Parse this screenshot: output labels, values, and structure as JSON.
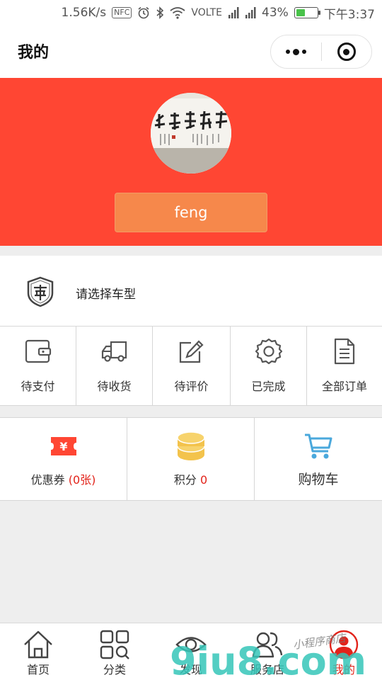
{
  "status_bar": {
    "speed": "1.56K/s",
    "nfc": "NFC",
    "volte": "VOLTE",
    "battery_pct": "43%",
    "battery_level": 0.43,
    "time": "下午3:37"
  },
  "header": {
    "title": "我的"
  },
  "profile": {
    "username": "feng"
  },
  "car_model": {
    "label": "请选择车型"
  },
  "orders": [
    {
      "label": "待支付",
      "icon": "wallet-icon"
    },
    {
      "label": "待收货",
      "icon": "truck-icon"
    },
    {
      "label": "待评价",
      "icon": "edit-icon"
    },
    {
      "label": "已完成",
      "icon": "gear-icon"
    },
    {
      "label": "全部订单",
      "icon": "document-icon"
    }
  ],
  "assets": {
    "coupon": {
      "label": "优惠券",
      "count": "(0张)",
      "icon": "coupon-icon"
    },
    "points": {
      "label": "积分",
      "count": "0",
      "icon": "coins-icon"
    },
    "cart": {
      "label": "购物车",
      "icon": "cart-icon"
    }
  },
  "tabs": [
    {
      "label": "首页",
      "icon": "home-icon"
    },
    {
      "label": "分类",
      "icon": "category-icon"
    },
    {
      "label": "发现",
      "icon": "eye-icon"
    },
    {
      "label": "服务店",
      "icon": "users-icon"
    },
    {
      "label": "我的",
      "icon": "profile-icon",
      "active": true
    }
  ],
  "watermark": {
    "text": "9iu8.com",
    "script": "小程序商店"
  },
  "colors": {
    "accent": "#ff4633",
    "username_button": "#f6884b",
    "active_tab": "#e2231a",
    "coin": "#f3c34c",
    "cart": "#4aa8dc"
  }
}
